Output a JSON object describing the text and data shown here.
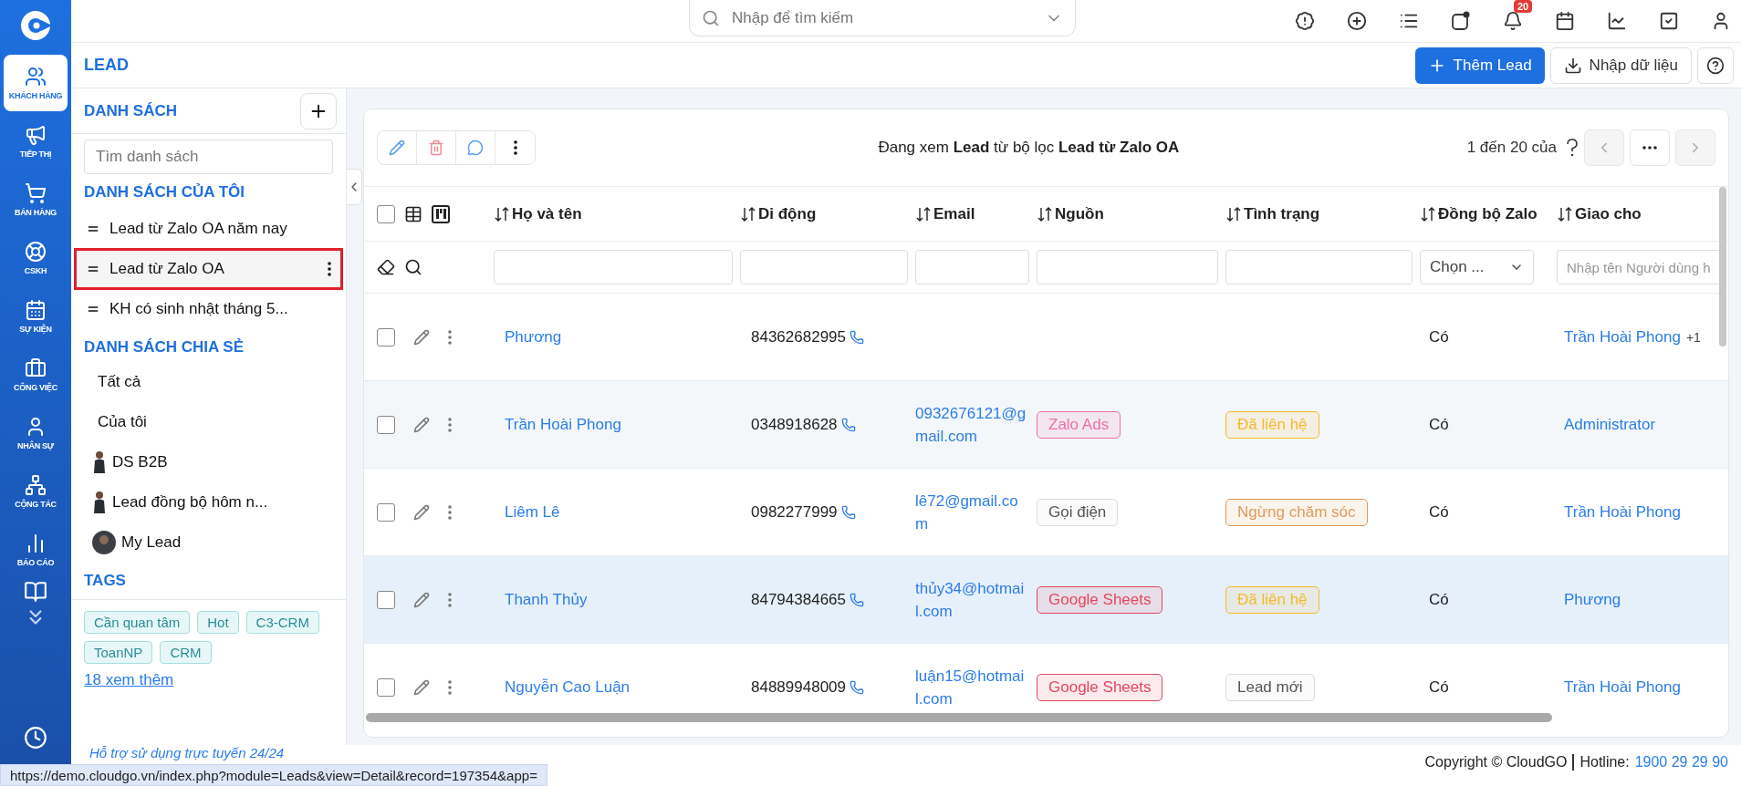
{
  "nav": {
    "items": [
      {
        "label": "KHÁCH HÀNG",
        "selected": true
      },
      {
        "label": "TIẾP THỊ",
        "selected": false
      },
      {
        "label": "BÁN HÀNG",
        "selected": false
      },
      {
        "label": "CSKH",
        "selected": false
      },
      {
        "label": "SỰ KIỆN",
        "selected": false
      },
      {
        "label": "CÔNG VIỆC",
        "selected": false
      },
      {
        "label": "NHÂN SỰ",
        "selected": false
      },
      {
        "label": "CỘNG TÁC",
        "selected": false
      },
      {
        "label": "BÁO CÁO",
        "selected": false
      }
    ]
  },
  "topbar": {
    "search": {
      "placeholder": "Nhập để tìm kiếm"
    },
    "notification_count": "20"
  },
  "page": {
    "title": "LEAD",
    "buttons": [
      {
        "label": "Thêm Lead",
        "kind": "primary"
      },
      {
        "label": "Nhập dữ liệu",
        "kind": "secondary"
      }
    ]
  },
  "sidebar": {
    "title": "DANH SÁCH",
    "search": {
      "placeholder": "Tìm danh sách"
    },
    "my_lists": {
      "title": "DANH SÁCH CỦA TÔI",
      "items": [
        {
          "label": "Lead từ Zalo OA năm nay",
          "selected": false
        },
        {
          "label": "Lead từ Zalo OA",
          "selected": true
        },
        {
          "label": "KH có sinh nhật tháng 5...",
          "selected": false
        }
      ]
    },
    "shared_lists": {
      "title": "DANH SÁCH CHIA SẺ",
      "items": [
        {
          "label": "Tất cả",
          "kind": "plain"
        },
        {
          "label": "Của tôi",
          "kind": "plain"
        },
        {
          "label": "DS B2B",
          "kind": "figure"
        },
        {
          "label": "Lead đồng bộ hôm n...",
          "kind": "figure"
        },
        {
          "label": "My Lead",
          "kind": "avatar"
        }
      ]
    },
    "tags": {
      "title": "TAGS",
      "items": [
        "Cần quan tâm",
        "Hot",
        "C3-CRM",
        "ToanNP",
        "CRM"
      ],
      "more_link": "18 xem thêm"
    },
    "support": "Hỗ trợ sử dụng trực tuyến 24/24"
  },
  "table": {
    "caption": "Đang xem **Lead** từ bộ lọc **Lead từ Zalo OA**",
    "pagination": "1 đến 20 của",
    "select_all_checked": false,
    "prev_disabled": true,
    "next_disabled": true,
    "columns": [
      "Họ và tên",
      "Di động",
      "Email",
      "Nguồn",
      "Tình trạng",
      "Đồng bộ Zalo",
      "Giao cho"
    ],
    "filters": [
      {
        "kind": "input"
      },
      {
        "kind": "input"
      },
      {
        "kind": "input"
      },
      {
        "kind": "input"
      },
      {
        "kind": "input"
      },
      {
        "kind": "select",
        "value": "Chọn ..."
      },
      {
        "kind": "input",
        "placeholder": "Nhập tên Người dùng h"
      }
    ],
    "rows": [
      {
        "checked": false,
        "highlighted": false,
        "name": "Phương",
        "mobile": "84362682995",
        "zalo_sync": "Có",
        "assigned_to": "Trần Hoài Phong",
        "assigned_extra": "+1"
      },
      {
        "checked": false,
        "highlighted": false,
        "name": "Trần Hoài Phong",
        "mobile": "0348918628",
        "email": "0932676121@gmail.com",
        "source": {
          "label": "Zalo Ads",
          "color": "#f06eaa"
        },
        "status": {
          "label": "Đã liên hệ",
          "color": "#f5b82e"
        },
        "zalo_sync": "Có",
        "assigned_to": "Administrator"
      },
      {
        "checked": false,
        "highlighted": false,
        "name": "Liêm Lê",
        "mobile": "0982277999",
        "email": "lê72@gmail.com",
        "source": {
          "label": "Gọi điện",
          "color": "#dcdcdc"
        },
        "status": {
          "label": "Ngừng chăm sóc",
          "color": "#de9a5c"
        },
        "zalo_sync": "Có",
        "assigned_to": "Trần Hoài Phong"
      },
      {
        "checked": false,
        "highlighted": true,
        "name": "Thanh Thủy",
        "mobile": "84794384665",
        "email": "thủy34@hotmail.com",
        "source": {
          "label": "Google Sheets",
          "color": "#e2475f"
        },
        "status": {
          "label": "Đã liên hệ",
          "color": "#f5b82e"
        },
        "zalo_sync": "Có",
        "assigned_to": "Phương"
      },
      {
        "checked": false,
        "highlighted": false,
        "name": "Nguyễn Cao Luận",
        "mobile": "84889948009",
        "email": "luận15@hotmail.com",
        "source": {
          "label": "Google Sheets",
          "color": "#e2475f"
        },
        "status": {
          "label": "Lead mới",
          "color": "#dcdcdc"
        },
        "zalo_sync": "Có",
        "assigned_to": "Trần Hoài Phong"
      }
    ]
  },
  "footer": {
    "copyright": "Copyright © CloudGO",
    "hotline_label": "Hotline:",
    "hotline": "1900 29 29 90"
  },
  "status_url": "https://demo.cloudgo.vn/index.php?module=Leads&view=Detail&record=197354&app="
}
